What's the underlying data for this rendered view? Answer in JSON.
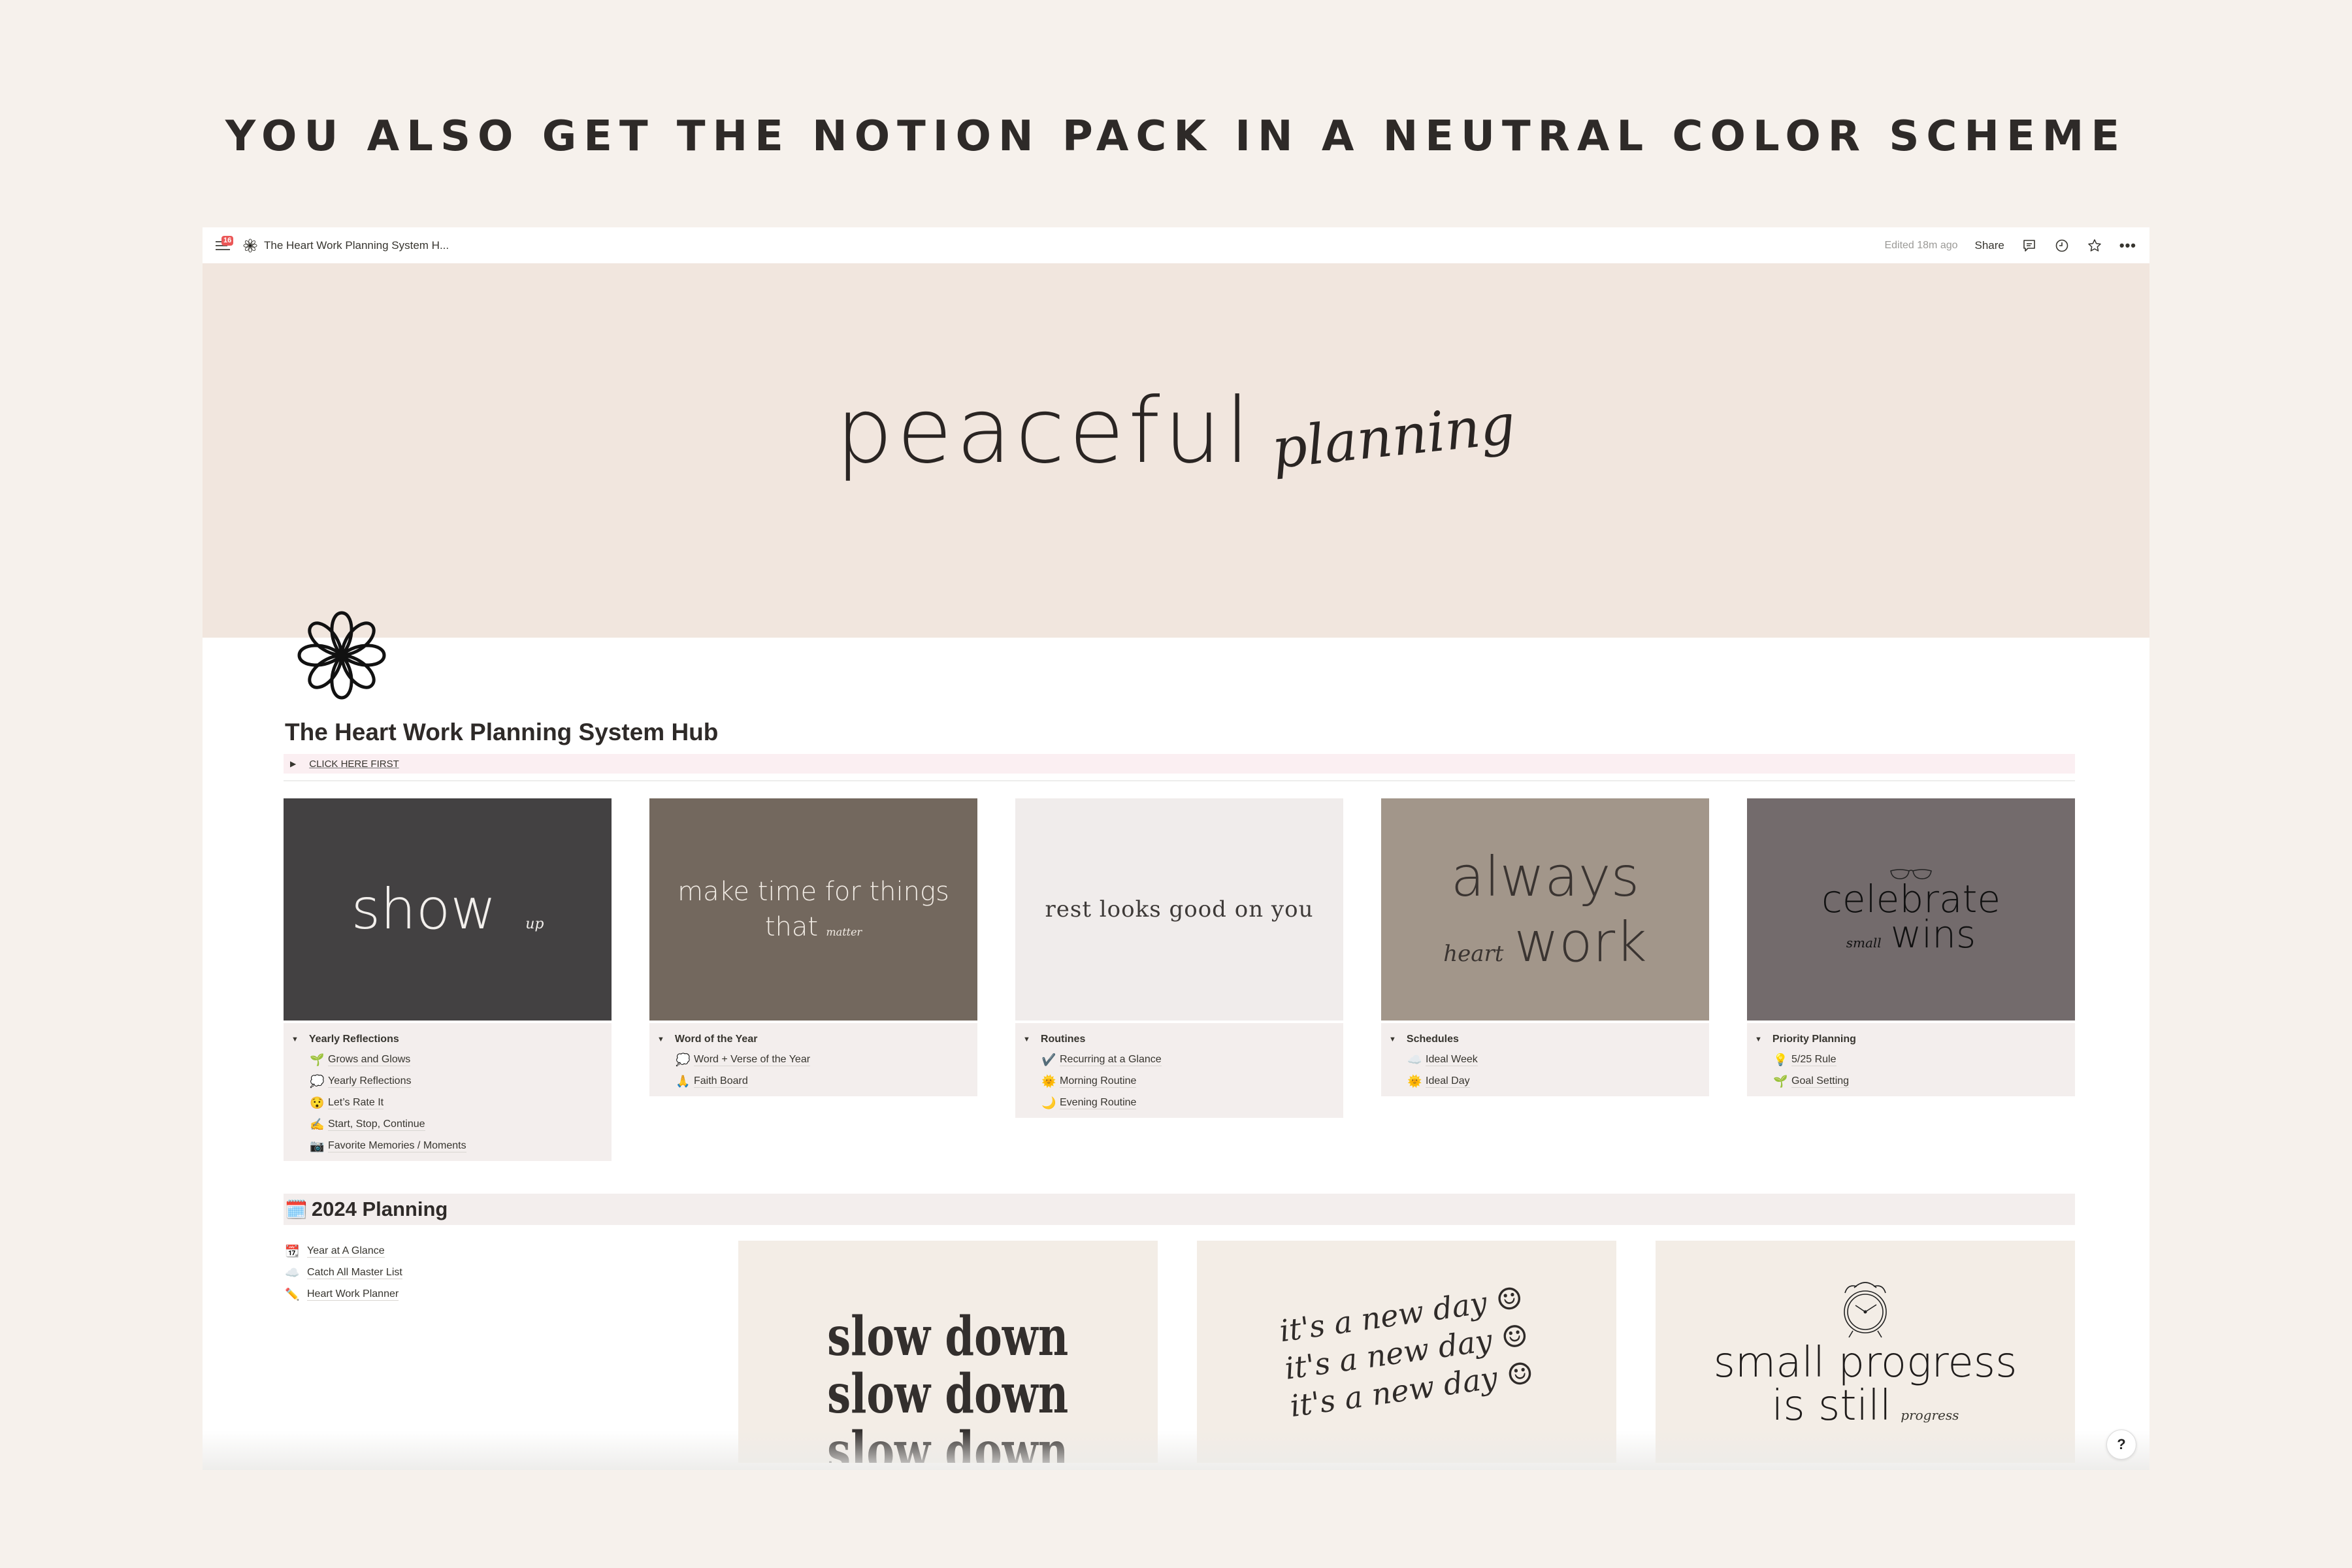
{
  "promo": {
    "headline": "YOU ALSO GET THE NOTION PACK IN A NEUTRAL COLOR SCHEME"
  },
  "topbar": {
    "notification_count": "16",
    "breadcrumb_title": "The Heart Work Planning System H...",
    "edited": "Edited 18m ago",
    "share_label": "Share",
    "icons": [
      "sidebar-toggle-icon",
      "flower-icon",
      "comment-icon",
      "clock-icon",
      "star-icon",
      "more-icon"
    ]
  },
  "cover": {
    "word_serif": "peaceful",
    "word_script": "planning"
  },
  "page": {
    "title": "The Heart Work Planning System Hub",
    "toggle_label": "CLICK HERE FIRST"
  },
  "cards": [
    {
      "cover_text": "show",
      "cover_script": "up",
      "heading": "Yearly Reflections",
      "items": [
        {
          "emoji": "🌱",
          "label": "Grows and Glows"
        },
        {
          "emoji": "💭",
          "label": "Yearly Reflections"
        },
        {
          "emoji": "😯",
          "label": "Let’s Rate It"
        },
        {
          "emoji": "✍️",
          "label": "Start, Stop, Continue"
        },
        {
          "emoji": "📷",
          "label": "Favorite Memories / Moments"
        }
      ]
    },
    {
      "cover_line1": "make time for things",
      "cover_line2": "that",
      "cover_script": "matter",
      "heading": "Word of the Year",
      "items": [
        {
          "emoji": "💭",
          "label": "Word + Verse of the Year"
        },
        {
          "emoji": "🙏",
          "label": "Faith Board"
        }
      ]
    },
    {
      "cover_text": "rest looks good on you",
      "heading": "Routines",
      "items": [
        {
          "emoji": "✔️",
          "label": "Recurring at a Glance"
        },
        {
          "emoji": "🌞",
          "label": "Morning Routine"
        },
        {
          "emoji": "🌙",
          "label": "Evening Routine"
        }
      ]
    },
    {
      "cover_line1": "always",
      "cover_script": "heart",
      "cover_line2": "work",
      "heading": "Schedules",
      "items": [
        {
          "emoji": "☁️",
          "label": "Ideal Week"
        },
        {
          "emoji": "🌞",
          "label": "Ideal Day"
        }
      ]
    },
    {
      "cover_line1": "celebrate",
      "cover_script": "small",
      "cover_line2": "wins",
      "heading": "Priority Planning",
      "items": [
        {
          "emoji": "💡",
          "label": "5/25 Rule"
        },
        {
          "emoji": "🌱",
          "label": "Goal Setting"
        }
      ]
    }
  ],
  "planning": {
    "heading_emoji": "🗓️",
    "heading": "2024 Planning",
    "items": [
      {
        "emoji": "📆",
        "label": "Year at A Glance"
      },
      {
        "emoji": "☁️",
        "label": "Catch All Master List"
      },
      {
        "emoji": "✏️",
        "label": "Heart Work Planner"
      }
    ],
    "gallery": [
      {
        "lines": [
          "slow down",
          "slow down",
          "slow down"
        ]
      },
      {
        "lines": [
          "it's a new day ☺",
          "it's a new day ☺",
          "it's a new day ☺"
        ]
      },
      {
        "line1": "small progress",
        "line2": "is still",
        "script": "progress"
      }
    ]
  },
  "help_label": "?",
  "colors": {
    "page_bg": "#f6f1ec",
    "cover_bg": "#f1e6de",
    "toggle_bg": "#fbeff2",
    "list_bg": "#f3eeed",
    "card1": "#434142",
    "card2": "#73685e",
    "card3": "#f0eceb",
    "card4": "#a2968a",
    "card5": "#736b6c",
    "badge": "#eb5757"
  }
}
